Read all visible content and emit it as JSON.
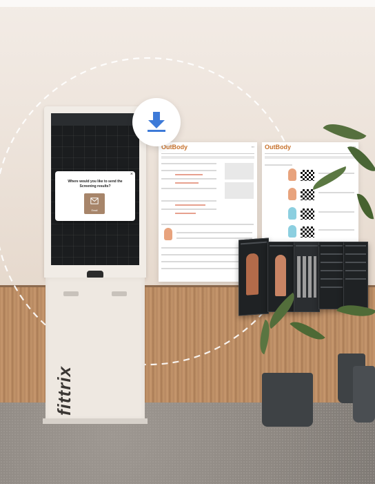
{
  "kiosk": {
    "brand": "fittrix",
    "dialog": {
      "title": "Where would you like to send the Screening results?",
      "email_label": "Email",
      "close_symbol": "×"
    }
  },
  "reports": [
    {
      "title": "OutBody"
    },
    {
      "title": "OutBody"
    }
  ],
  "colors": {
    "accent_blue": "#3d7ad8",
    "report_orange": "#c7722d",
    "email_button": "#a7856a"
  }
}
